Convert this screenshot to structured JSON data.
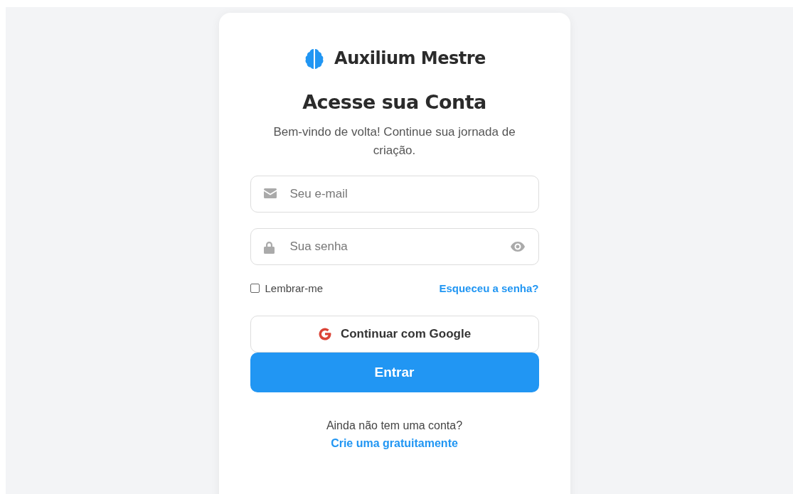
{
  "brand": {
    "name": "Auxilium Mestre"
  },
  "heading": "Acesse sua Conta",
  "subtitle": "Bem-vindo de volta! Continue sua jornada de criação.",
  "fields": [
    {
      "kind": "email",
      "placeholder": "Seu e-mail"
    },
    {
      "kind": "password",
      "placeholder": "Sua senha"
    }
  ],
  "remember": {
    "label": "Lembrar-me",
    "checked": false
  },
  "forgot_link": "Esqueceu a senha?",
  "google_button": "Continuar com Google",
  "submit_button": "Entrar",
  "footer": {
    "text": "Ainda não tem uma conta?",
    "link": "Crie uma gratuitamente"
  }
}
